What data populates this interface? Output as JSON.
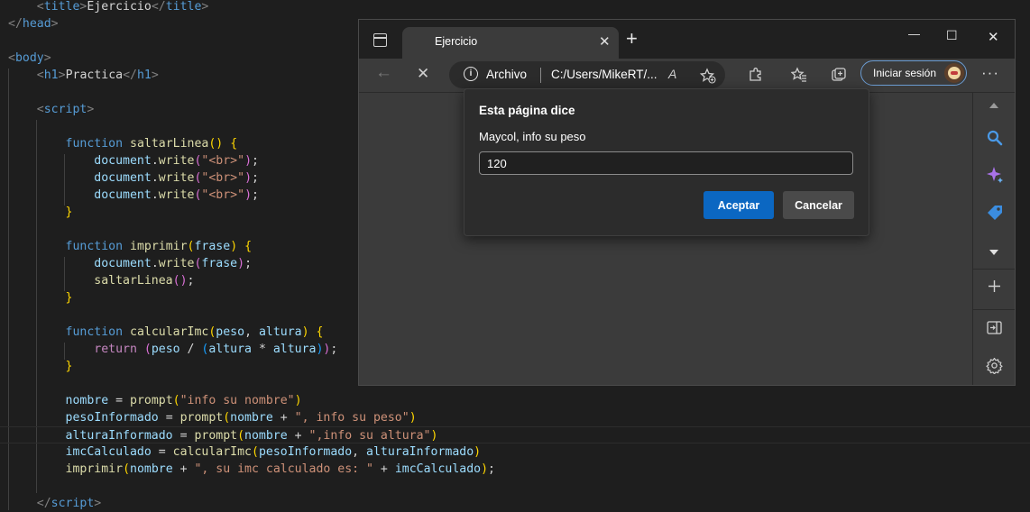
{
  "editor": {
    "lines": [
      [
        [
          "t-angle",
          "    <"
        ],
        [
          "t-tag",
          "title"
        ],
        [
          "t-angle",
          ">"
        ],
        [
          "t-txt",
          "Ejercicio"
        ],
        [
          "t-angle",
          "</"
        ],
        [
          "t-tag",
          "title"
        ],
        [
          "t-angle",
          ">"
        ]
      ],
      [
        [
          "t-angle",
          "</"
        ],
        [
          "t-tag",
          "head"
        ],
        [
          "t-angle",
          ">"
        ]
      ],
      [],
      [
        [
          "t-angle",
          "<"
        ],
        [
          "t-tag",
          "body"
        ],
        [
          "t-angle",
          ">"
        ]
      ],
      [
        [
          "t-txt",
          "    "
        ],
        [
          "t-angle",
          "<"
        ],
        [
          "t-tag",
          "h1"
        ],
        [
          "t-angle",
          ">"
        ],
        [
          "t-txt",
          "Practica"
        ],
        [
          "t-angle",
          "</"
        ],
        [
          "t-tag",
          "h1"
        ],
        [
          "t-angle",
          ">"
        ]
      ],
      [],
      [
        [
          "t-txt",
          "    "
        ],
        [
          "t-angle",
          "<"
        ],
        [
          "t-tag",
          "script"
        ],
        [
          "t-angle",
          ">"
        ]
      ],
      [],
      [
        [
          "t-txt",
          "        "
        ],
        [
          "t-kw",
          "function "
        ],
        [
          "t-fn",
          "saltarLinea"
        ],
        [
          "t-b1",
          "()"
        ],
        [
          "t-txt",
          " "
        ],
        [
          "t-b1",
          "{"
        ]
      ],
      [
        [
          "t-txt",
          "            "
        ],
        [
          "t-var",
          "document"
        ],
        [
          "t-txt",
          "."
        ],
        [
          "t-fn",
          "write"
        ],
        [
          "t-b2",
          "("
        ],
        [
          "t-str",
          "\"<br>\""
        ],
        [
          "t-b2",
          ")"
        ],
        [
          "t-txt",
          ";"
        ]
      ],
      [
        [
          "t-txt",
          "            "
        ],
        [
          "t-var",
          "document"
        ],
        [
          "t-txt",
          "."
        ],
        [
          "t-fn",
          "write"
        ],
        [
          "t-b2",
          "("
        ],
        [
          "t-str",
          "\"<br>\""
        ],
        [
          "t-b2",
          ")"
        ],
        [
          "t-txt",
          ";"
        ]
      ],
      [
        [
          "t-txt",
          "            "
        ],
        [
          "t-var",
          "document"
        ],
        [
          "t-txt",
          "."
        ],
        [
          "t-fn",
          "write"
        ],
        [
          "t-b2",
          "("
        ],
        [
          "t-str",
          "\"<br>\""
        ],
        [
          "t-b2",
          ")"
        ],
        [
          "t-txt",
          ";"
        ]
      ],
      [
        [
          "t-txt",
          "        "
        ],
        [
          "t-b1",
          "}"
        ]
      ],
      [],
      [
        [
          "t-txt",
          "        "
        ],
        [
          "t-kw",
          "function "
        ],
        [
          "t-fn",
          "imprimir"
        ],
        [
          "t-b1",
          "("
        ],
        [
          "t-var",
          "frase"
        ],
        [
          "t-b1",
          ")"
        ],
        [
          "t-txt",
          " "
        ],
        [
          "t-b1",
          "{"
        ]
      ],
      [
        [
          "t-txt",
          "            "
        ],
        [
          "t-var",
          "document"
        ],
        [
          "t-txt",
          "."
        ],
        [
          "t-fn",
          "write"
        ],
        [
          "t-b2",
          "("
        ],
        [
          "t-var",
          "frase"
        ],
        [
          "t-b2",
          ")"
        ],
        [
          "t-txt",
          ";"
        ]
      ],
      [
        [
          "t-txt",
          "            "
        ],
        [
          "t-fn",
          "saltarLinea"
        ],
        [
          "t-b2",
          "()"
        ],
        [
          "t-txt",
          ";"
        ]
      ],
      [
        [
          "t-txt",
          "        "
        ],
        [
          "t-b1",
          "}"
        ]
      ],
      [],
      [
        [
          "t-txt",
          "        "
        ],
        [
          "t-kw",
          "function "
        ],
        [
          "t-fn",
          "calcularImc"
        ],
        [
          "t-b1",
          "("
        ],
        [
          "t-var",
          "peso"
        ],
        [
          "t-txt",
          ", "
        ],
        [
          "t-var",
          "altura"
        ],
        [
          "t-b1",
          ")"
        ],
        [
          "t-txt",
          " "
        ],
        [
          "t-b1",
          "{"
        ]
      ],
      [
        [
          "t-txt",
          "            "
        ],
        [
          "t-ctrl",
          "return "
        ],
        [
          "t-b2",
          "("
        ],
        [
          "t-var",
          "peso"
        ],
        [
          "t-txt",
          " / "
        ],
        [
          "t-b3",
          "("
        ],
        [
          "t-var",
          "altura"
        ],
        [
          "t-txt",
          " * "
        ],
        [
          "t-var",
          "altura"
        ],
        [
          "t-b3",
          ")"
        ],
        [
          "t-b2",
          ")"
        ],
        [
          "t-txt",
          ";"
        ]
      ],
      [
        [
          "t-txt",
          "        "
        ],
        [
          "t-b1",
          "}"
        ]
      ],
      [],
      [
        [
          "t-txt",
          "        "
        ],
        [
          "t-var",
          "nombre"
        ],
        [
          "t-txt",
          " = "
        ],
        [
          "t-fn",
          "prompt"
        ],
        [
          "t-b1",
          "("
        ],
        [
          "t-str",
          "\"info su nombre\""
        ],
        [
          "t-b1",
          ")"
        ]
      ],
      [
        [
          "t-txt",
          "        "
        ],
        [
          "t-var",
          "pesoInformado"
        ],
        [
          "t-txt",
          " = "
        ],
        [
          "t-fn",
          "prompt"
        ],
        [
          "t-b1",
          "("
        ],
        [
          "t-var",
          "nombre"
        ],
        [
          "t-txt",
          " + "
        ],
        [
          "t-str",
          "\", info su peso\""
        ],
        [
          "t-b1",
          ")"
        ]
      ],
      [
        [
          "t-txt",
          "        "
        ],
        [
          "t-var",
          "alturaInformado"
        ],
        [
          "t-txt",
          " = "
        ],
        [
          "t-fn",
          "prompt"
        ],
        [
          "t-b1",
          "("
        ],
        [
          "t-var",
          "nombre"
        ],
        [
          "t-txt",
          " + "
        ],
        [
          "t-str",
          "\",info su altura\""
        ],
        [
          "t-b1",
          ")"
        ]
      ],
      [
        [
          "t-txt",
          "        "
        ],
        [
          "t-var",
          "imcCalculado"
        ],
        [
          "t-txt",
          " = "
        ],
        [
          "t-fn",
          "calcularImc"
        ],
        [
          "t-b1",
          "("
        ],
        [
          "t-var",
          "pesoInformado"
        ],
        [
          "t-txt",
          ", "
        ],
        [
          "t-var",
          "alturaInformado"
        ],
        [
          "t-b1",
          ")"
        ]
      ],
      [
        [
          "t-txt",
          "        "
        ],
        [
          "t-fn",
          "imprimir"
        ],
        [
          "t-b1",
          "("
        ],
        [
          "t-var",
          "nombre"
        ],
        [
          "t-txt",
          " + "
        ],
        [
          "t-str",
          "\", su imc calculado es: \""
        ],
        [
          "t-txt",
          " + "
        ],
        [
          "t-var",
          "imcCalculado"
        ],
        [
          "t-b1",
          ")"
        ],
        [
          "t-txt",
          ";"
        ]
      ],
      [],
      [
        [
          "t-txt",
          "    "
        ],
        [
          "t-angle",
          "</"
        ],
        [
          "t-tag",
          "script"
        ],
        [
          "t-angle",
          ">"
        ]
      ]
    ],
    "current_line_index": 25
  },
  "browser": {
    "tab_title": "Ejercicio",
    "tab_close": "✕",
    "new_tab": "+",
    "minimize": "—",
    "maximize": "☐",
    "close": "✕",
    "back": "←",
    "stop": "✕",
    "address": {
      "info_glyph": "i",
      "site_label": "Archivo",
      "url": "C:/Users/MikeRT/..."
    },
    "read_aloud": "A",
    "sign_in_label": "Iniciar sesión",
    "more": "···",
    "sidebar_icons": [
      "scroll-up-icon",
      "search-icon",
      "copilot-icon",
      "shopping-tag-icon",
      "scroll-down-icon",
      "add-icon",
      "split-screen-icon",
      "settings-icon"
    ]
  },
  "dialog": {
    "title": "Esta página dice",
    "message": "Maycol, info su peso",
    "input_value": "120",
    "ok_label": "Aceptar",
    "cancel_label": "Cancelar"
  },
  "colors": {
    "editor_bg": "#1e1e1e",
    "browser_chrome": "#202020",
    "browser_page": "#3b3b3b",
    "dialog_bg": "#2c2c2c",
    "accent": "#0b67c2"
  }
}
